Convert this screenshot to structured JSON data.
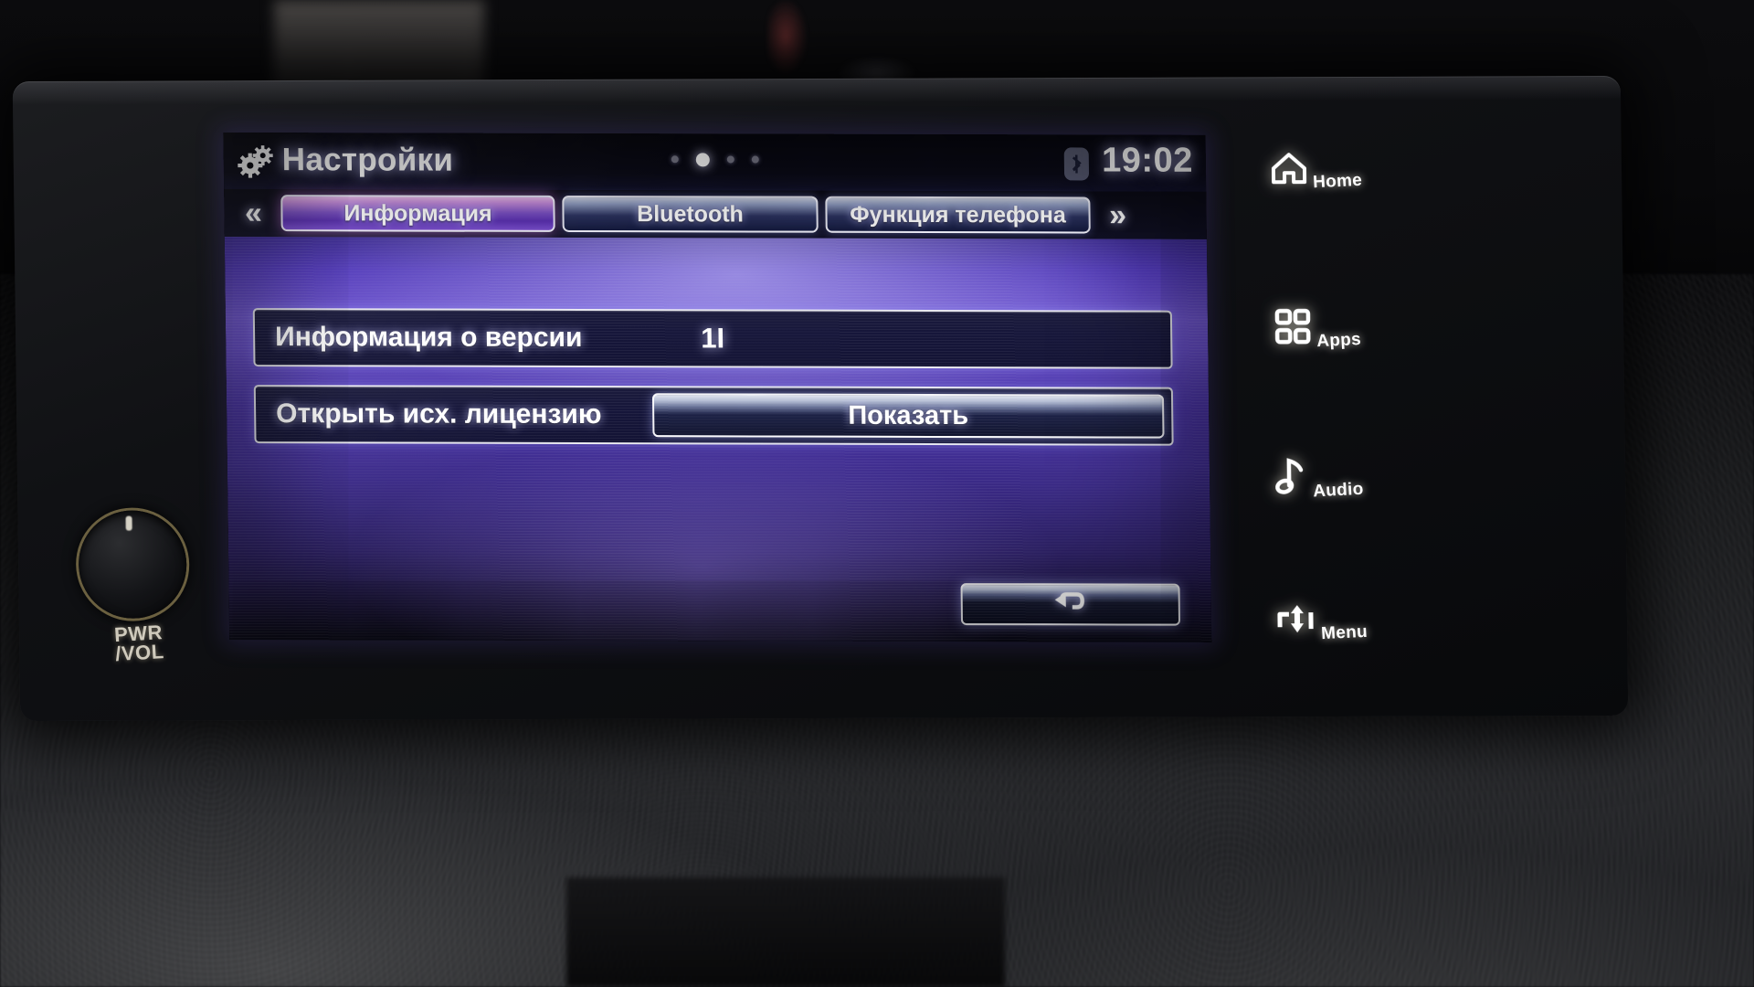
{
  "device": {
    "knob_label_line1": "PWR",
    "knob_label_line2": "/VOL"
  },
  "status_bar": {
    "icon": "gears-icon",
    "title": "Настройки",
    "page_dots": {
      "count": 4,
      "active_index": 1
    },
    "bluetooth_icon": "bluetooth-icon",
    "clock": "19:02"
  },
  "tab_bar": {
    "prev_arrow": "«",
    "next_arrow": "»",
    "tabs": [
      {
        "label": "Информация",
        "active": true
      },
      {
        "label": "Bluetooth",
        "active": false
      },
      {
        "label": "Функция телефона",
        "active": false
      }
    ]
  },
  "content": {
    "rows": [
      {
        "label": "Информация о версии",
        "value": "1I",
        "has_button": false
      },
      {
        "label": "Открыть исх. лицензию",
        "button_label": "Показать",
        "has_button": true
      }
    ],
    "back_button_icon": "back-arrow-icon"
  },
  "hard_keys": [
    {
      "label": "Home",
      "icon": "home-icon"
    },
    {
      "label": "Apps",
      "icon": "apps-grid-icon"
    },
    {
      "label": "Audio",
      "icon": "music-note-icon"
    },
    {
      "label": "Menu",
      "icon": "menu-updown-icon"
    }
  ],
  "colors": {
    "accent_active_tab": "#7a4fc4",
    "tab_inactive": "#2c3360",
    "content_bg": "#5038b8",
    "text": "#ffffff"
  }
}
